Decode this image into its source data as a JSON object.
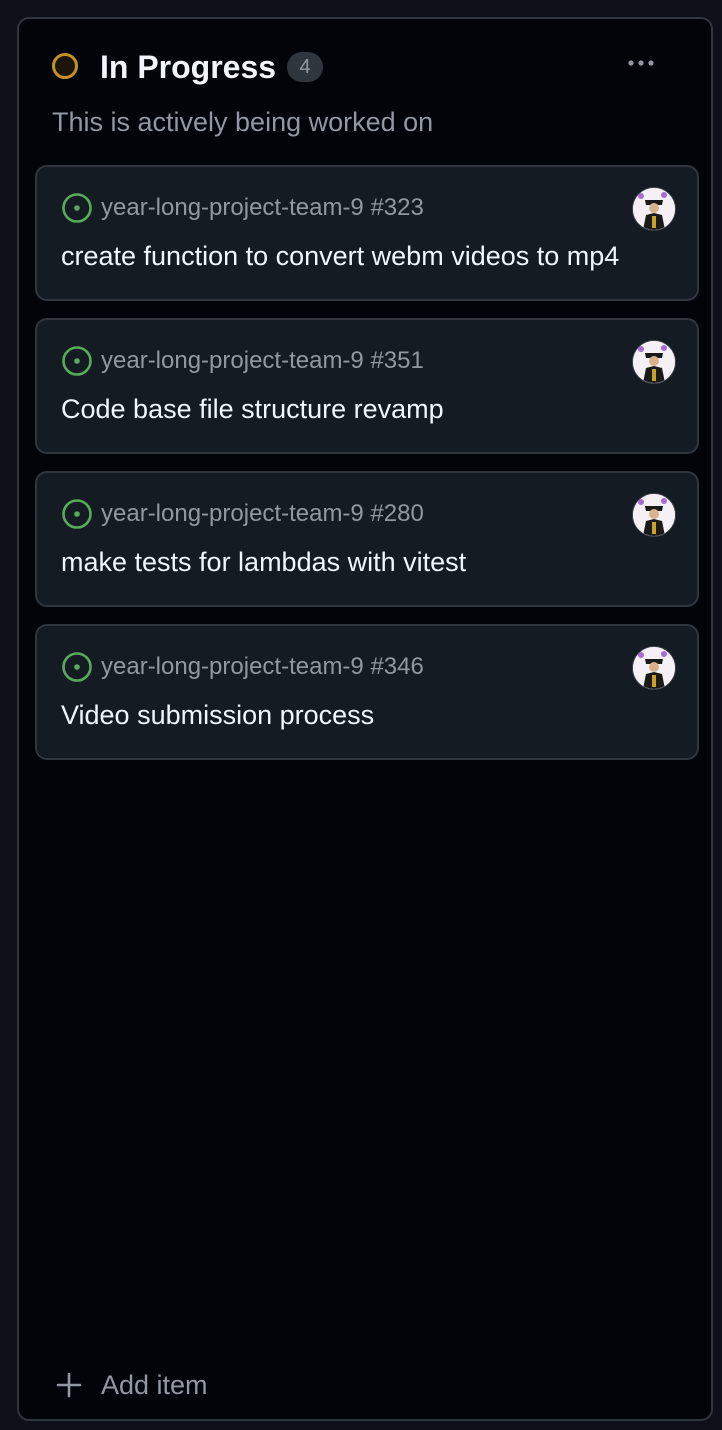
{
  "column": {
    "status_color": "#c69026",
    "title": "In Progress",
    "count": "4",
    "description": "This is actively being worked on",
    "more_icon": "kebab-horizontal-icon"
  },
  "cards": [
    {
      "repo_ref": "year-long-project-team-9 #323",
      "title": "create function to convert webm videos to mp4",
      "status_icon": "issue-open-icon",
      "avatar": "assignee-avatar"
    },
    {
      "repo_ref": "year-long-project-team-9 #351",
      "title": "Code base file structure revamp",
      "status_icon": "issue-open-icon",
      "avatar": "assignee-avatar"
    },
    {
      "repo_ref": "year-long-project-team-9 #280",
      "title": "make tests for lambdas with vitest",
      "status_icon": "issue-open-icon",
      "avatar": "assignee-avatar"
    },
    {
      "repo_ref": "year-long-project-team-9 #346",
      "title": "Video submission process",
      "status_icon": "issue-open-icon",
      "avatar": "assignee-avatar"
    }
  ],
  "footer": {
    "add_label": "Add item",
    "add_icon": "plus-icon"
  },
  "colors": {
    "issue_open": "#57ab5a",
    "background": "#010409",
    "card": "#151b23",
    "muted_text": "#9198a1"
  }
}
